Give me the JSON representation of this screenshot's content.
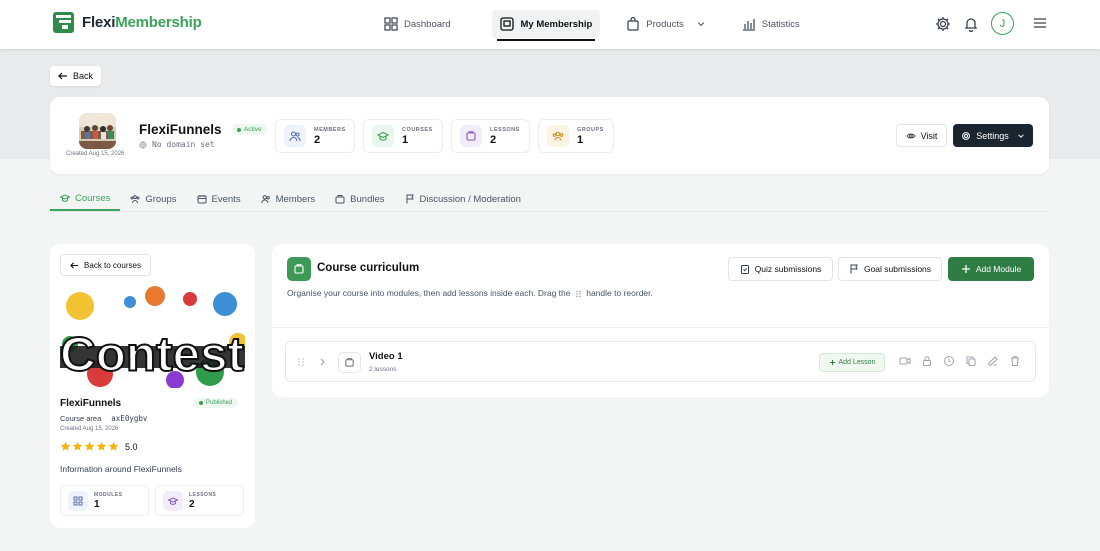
{
  "app": {
    "logo_part1": "Flexi",
    "logo_part2": "Membership",
    "avatar_initial": "J"
  },
  "nav": [
    {
      "label": "Dashboard",
      "icon": "dashboard-icon"
    },
    {
      "label": "My Membership",
      "icon": "membership-icon",
      "active": true
    },
    {
      "label": "Products",
      "icon": "bag-icon"
    },
    {
      "label": "Statistics",
      "icon": "chart-icon"
    }
  ],
  "back_label": "Back",
  "membership": {
    "title": "FlexiFunnels",
    "status": "Active",
    "domain": "No domain set",
    "created": "Created Aug 15, 2026",
    "stats": [
      {
        "label": "MEMBERS",
        "value": "2"
      },
      {
        "label": "COURSES",
        "value": "1"
      },
      {
        "label": "LESSONS",
        "value": "2"
      },
      {
        "label": "GROUPS",
        "value": "1"
      }
    ],
    "visit_label": "Visit",
    "settings_label": "Settings"
  },
  "tabs": [
    "Courses",
    "Groups",
    "Events",
    "Members",
    "Bundles",
    "Discussion / Moderation"
  ],
  "course": {
    "back_label": "Back to courses",
    "image_text": "Contest",
    "name": "FlexiFunnels",
    "status": "Published",
    "area_label": "Course area",
    "area_code": "axE0ygbv",
    "created": "Created Aug 15, 2026",
    "rating": "5.0",
    "rating_stars": 5,
    "description": "Information around FlexiFunnels",
    "stats": [
      {
        "label": "MODULES",
        "value": "1"
      },
      {
        "label": "LESSONS",
        "value": "2"
      }
    ]
  },
  "curriculum": {
    "title": "Course curriculum",
    "desc_before": "Organise your course into modules, then add lessons inside each. Drag the",
    "desc_after": "handle to reorder.",
    "quiz_label": "Quiz submissions",
    "goal_label": "Goal submissions",
    "add_module_label": "Add Module",
    "modules": [
      {
        "name": "Video 1",
        "count": "2 lessons",
        "add_lesson_label": "Add Lesson"
      }
    ]
  },
  "colors": {
    "brand_green": "#3aa35a",
    "dark": "#1b2530"
  }
}
